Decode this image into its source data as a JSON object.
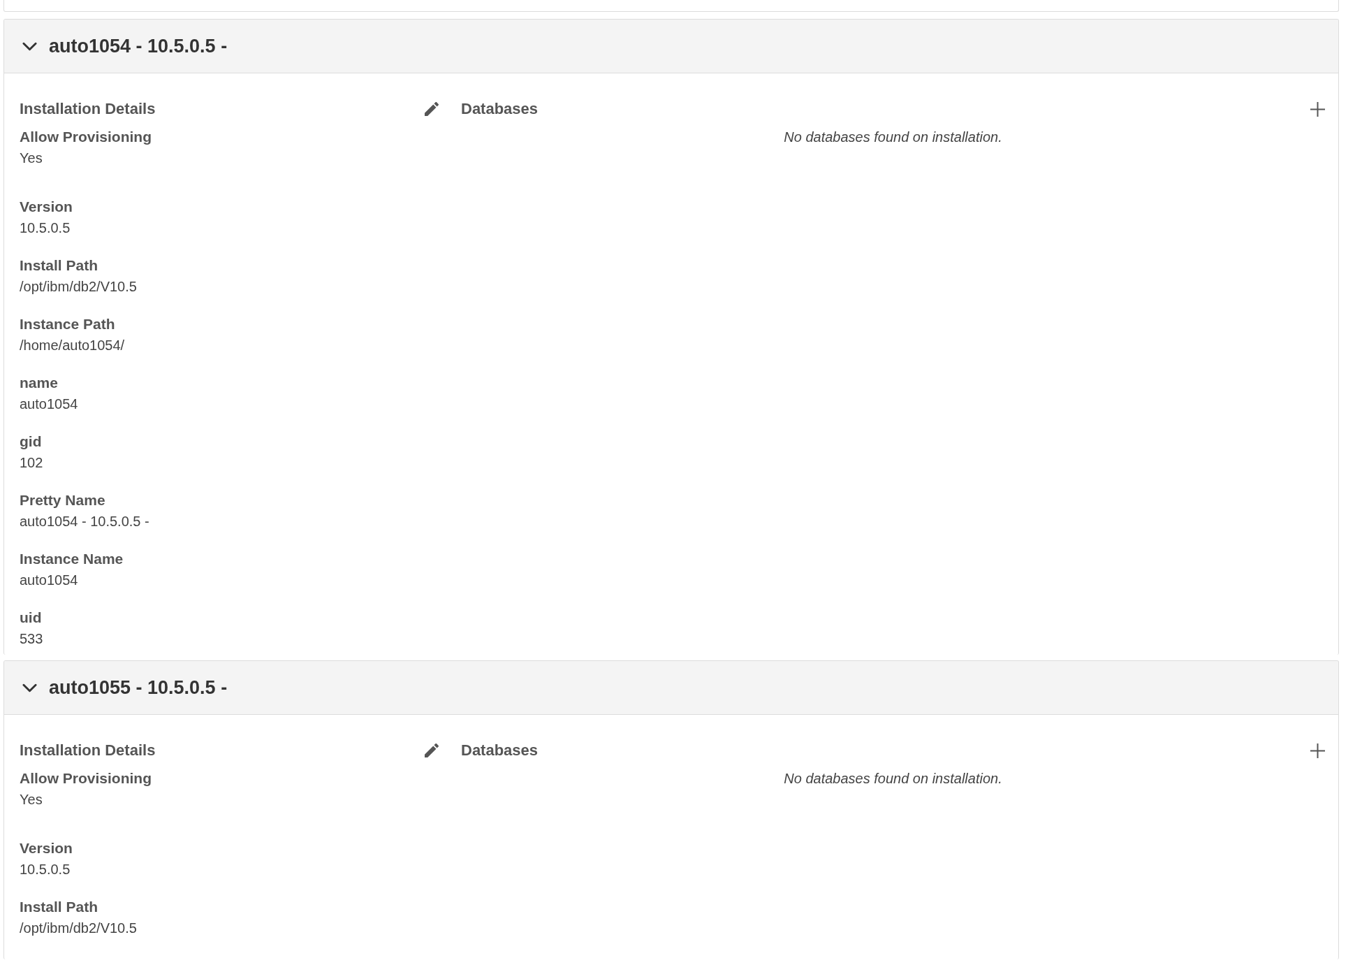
{
  "installations": [
    {
      "title": "auto1054 - 10.5.0.5 -",
      "expanded": true,
      "details": {
        "heading": "Installation Details",
        "provisioning": {
          "label": "Allow Provisioning",
          "value": "Yes"
        },
        "properties": [
          {
            "label": "Version",
            "value": "10.5.0.5"
          },
          {
            "label": "Install Path",
            "value": "/opt/ibm/db2/V10.5"
          },
          {
            "label": "Instance Path",
            "value": "/home/auto1054/"
          },
          {
            "label": "name",
            "value": "auto1054"
          },
          {
            "label": "gid",
            "value": "102"
          },
          {
            "label": "Pretty Name",
            "value": "auto1054 - 10.5.0.5 -"
          },
          {
            "label": "Instance Name",
            "value": "auto1054"
          },
          {
            "label": "uid",
            "value": "533"
          }
        ]
      },
      "databases": {
        "heading": "Databases",
        "empty_message": "No databases found on installation."
      }
    },
    {
      "title": "auto1055 - 10.5.0.5 -",
      "expanded": true,
      "details": {
        "heading": "Installation Details",
        "provisioning": {
          "label": "Allow Provisioning",
          "value": "Yes"
        },
        "properties": [
          {
            "label": "Version",
            "value": "10.5.0.5"
          },
          {
            "label": "Install Path",
            "value": "/opt/ibm/db2/V10.5"
          }
        ]
      },
      "databases": {
        "heading": "Databases",
        "empty_message": "No databases found on installation."
      }
    }
  ]
}
